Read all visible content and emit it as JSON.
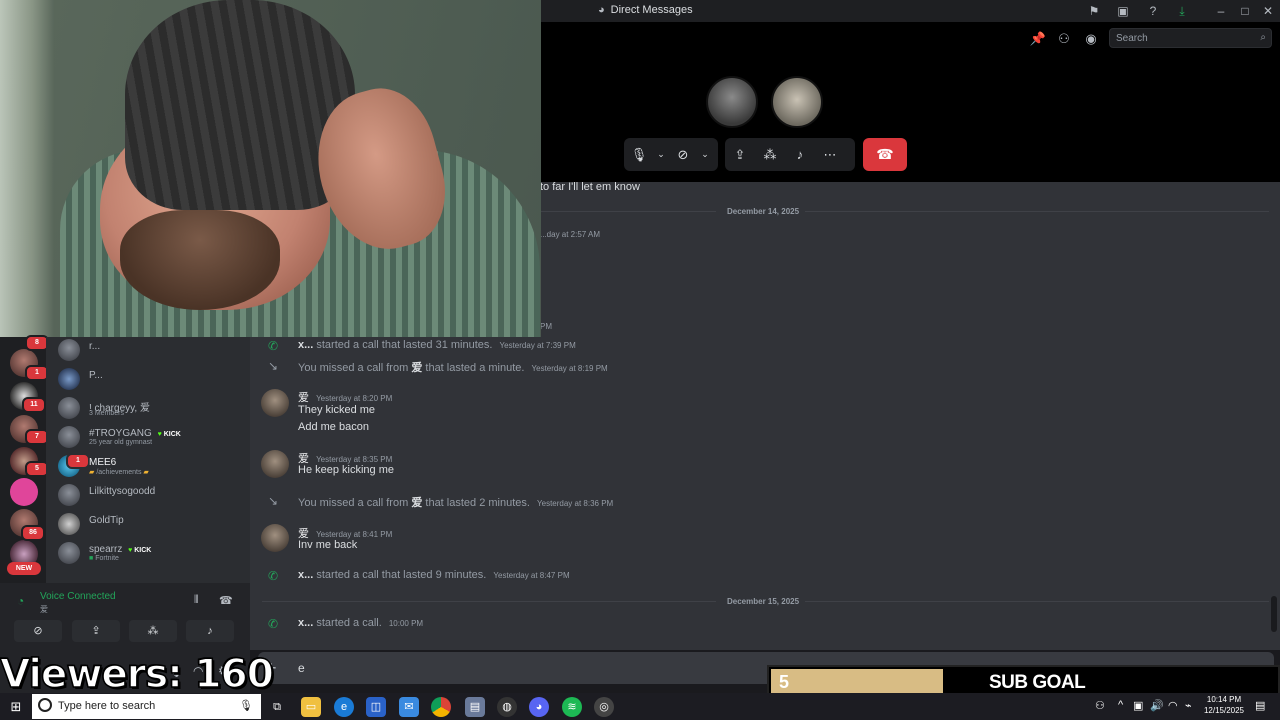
{
  "window": {
    "title": "Direct Messages"
  },
  "search": {
    "placeholder": "Search"
  },
  "chat": {
    "partial_line": "to far I'll let em know",
    "date_dec14": "December 14, 2025",
    "partial_ts": "...day at 2:57 AM",
    "partial_pm": "PM",
    "events": [
      {
        "kind": "call",
        "user": "x...",
        "text": "started a call that lasted 31 minutes.",
        "ts": "Yesterday at 7:39 PM"
      },
      {
        "kind": "missed",
        "text_pre": "You missed a call from",
        "user": "爱",
        "text_post": "that lasted a minute.",
        "ts": "Yesterday at 8:19 PM"
      }
    ],
    "msg1": {
      "author": "爱",
      "ts": "Yesterday at 8:20 PM",
      "lines": [
        "They kicked me",
        "Add me bacon"
      ]
    },
    "msg2": {
      "author": "爱",
      "ts": "Yesterday at 8:35 PM",
      "lines": [
        "He keep kicking me"
      ]
    },
    "missed2": {
      "text_pre": "You missed a call from",
      "user": "爱",
      "text_post": "that lasted 2 minutes.",
      "ts": "Yesterday at 8:36 PM"
    },
    "msg3": {
      "author": "爱",
      "ts": "Yesterday at 8:41 PM",
      "lines": [
        "Inv me back"
      ]
    },
    "call2": {
      "user": "x...",
      "text": "started a call that lasted 9 minutes.",
      "ts": "Yesterday at 8:47 PM"
    },
    "date_dec15": "December 15, 2025",
    "call3": {
      "user": "x...",
      "text": "started a call.",
      "ts": "10:00 PM"
    }
  },
  "input": {
    "value": "e"
  },
  "servers": {
    "badges": [
      "8",
      "1",
      "11",
      "7",
      "5",
      "86"
    ],
    "new_label": "NEW"
  },
  "dms": [
    {
      "name": "r...",
      "sub": ""
    },
    {
      "name": "P...",
      "sub": ""
    },
    {
      "name": "! chargeyy, 爱",
      "sub": "3 Members"
    },
    {
      "name": "#TROYGANG",
      "kick": "KICK",
      "sub": "25 year old gymnast"
    },
    {
      "name": "MEE6",
      "sub": "/achievements",
      "badge": "1"
    },
    {
      "name": "Lilkittysogoodd",
      "sub": ""
    },
    {
      "name": "GoldTip",
      "sub": ""
    },
    {
      "name": "spearrz",
      "kick": "KICK",
      "sub": "Fortnite"
    }
  ],
  "voice": {
    "status": "Voice Connected",
    "channel": "爱"
  },
  "overlay": {
    "viewers": "Viewers: 160",
    "sub_goal_count": "5",
    "sub_goal_label": "SUB GOAL",
    "sub_goal_progress": 0.34
  },
  "taskbar": {
    "search_placeholder": "Type here to search",
    "time": "10:14 PM",
    "date": "12/15/2025"
  },
  "colors": {
    "accent_green": "#23a55a",
    "hangup_red": "#da373c",
    "goal_fill": "#d8bc84",
    "kick_green": "#53fc18"
  }
}
